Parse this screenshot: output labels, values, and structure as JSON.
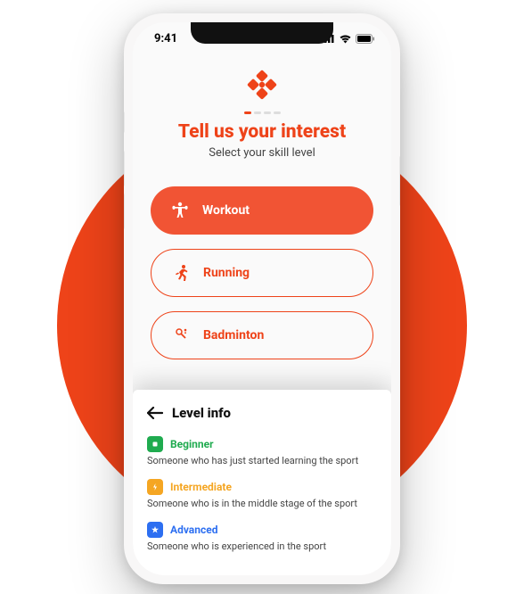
{
  "status": {
    "time": "9:41"
  },
  "title": "Tell us your interest",
  "subtitle": "Select your skill level",
  "options": [
    {
      "label": "Workout",
      "icon": "dumbbell-icon",
      "selected": true
    },
    {
      "label": "Running",
      "icon": "runner-icon",
      "selected": false
    },
    {
      "label": "Badminton",
      "icon": "badminton-icon",
      "selected": false
    }
  ],
  "sheet": {
    "title": "Level info",
    "levels": [
      {
        "name": "Beginner",
        "desc": "Someone who has just started learning the sport",
        "color": "green",
        "icon": "square-icon"
      },
      {
        "name": "Intermediate",
        "desc": "Someone who is in the middle stage of the sport",
        "color": "orange",
        "icon": "bolt-icon"
      },
      {
        "name": "Advanced",
        "desc": "Someone who is experienced in the sport",
        "color": "blue",
        "icon": "star-icon"
      }
    ]
  }
}
